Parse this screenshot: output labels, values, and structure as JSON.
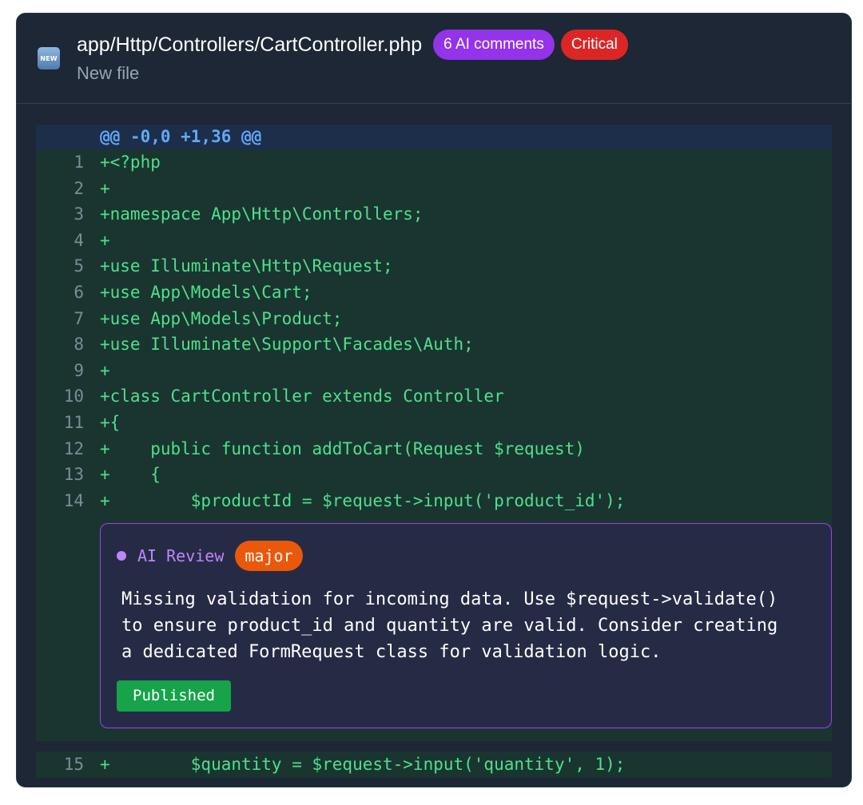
{
  "file": {
    "badge_icon": "NEW",
    "path": "app/Http/Controllers/CartController.php",
    "ai_comments_badge": "6 AI comments",
    "severity_badge": "Critical",
    "status": "New file"
  },
  "diff": {
    "hunk_header": "@@ -0,0 +1,36 @@",
    "lines": [
      {
        "num": "1",
        "code": "+<?php"
      },
      {
        "num": "2",
        "code": "+"
      },
      {
        "num": "3",
        "code": "+namespace App\\Http\\Controllers;"
      },
      {
        "num": "4",
        "code": "+"
      },
      {
        "num": "5",
        "code": "+use Illuminate\\Http\\Request;"
      },
      {
        "num": "6",
        "code": "+use App\\Models\\Cart;"
      },
      {
        "num": "7",
        "code": "+use App\\Models\\Product;"
      },
      {
        "num": "8",
        "code": "+use Illuminate\\Support\\Facades\\Auth;"
      },
      {
        "num": "9",
        "code": "+"
      },
      {
        "num": "10",
        "code": "+class CartController extends Controller"
      },
      {
        "num": "11",
        "code": "+{"
      },
      {
        "num": "12",
        "code": "+    public function addToCart(Request $request)"
      },
      {
        "num": "13",
        "code": "+    {"
      },
      {
        "num": "14",
        "code": "+        $productId = $request->input('product_id');"
      }
    ],
    "after_comment_line": {
      "num": "15",
      "code": "+        $quantity = $request->input('quantity', 1);"
    }
  },
  "comment": {
    "label": "AI Review",
    "severity": "major",
    "text_lines": [
      "Missing validation for incoming data. Use $request->validate()",
      "to ensure product_id and quantity are valid. Consider creating",
      "a dedicated FormRequest class for validation logic."
    ],
    "status": "Published"
  },
  "colors": {
    "card_bg": "#1d2735",
    "added_line_bg": "#1a3530",
    "added_code": "#4ee08b",
    "hunk_text": "#62a8f5",
    "ai_badge": "#9333ea",
    "critical_badge": "#dc2626",
    "major_badge": "#ea580c",
    "published_badge": "#16a34a",
    "comment_border": "#9b45e8"
  }
}
